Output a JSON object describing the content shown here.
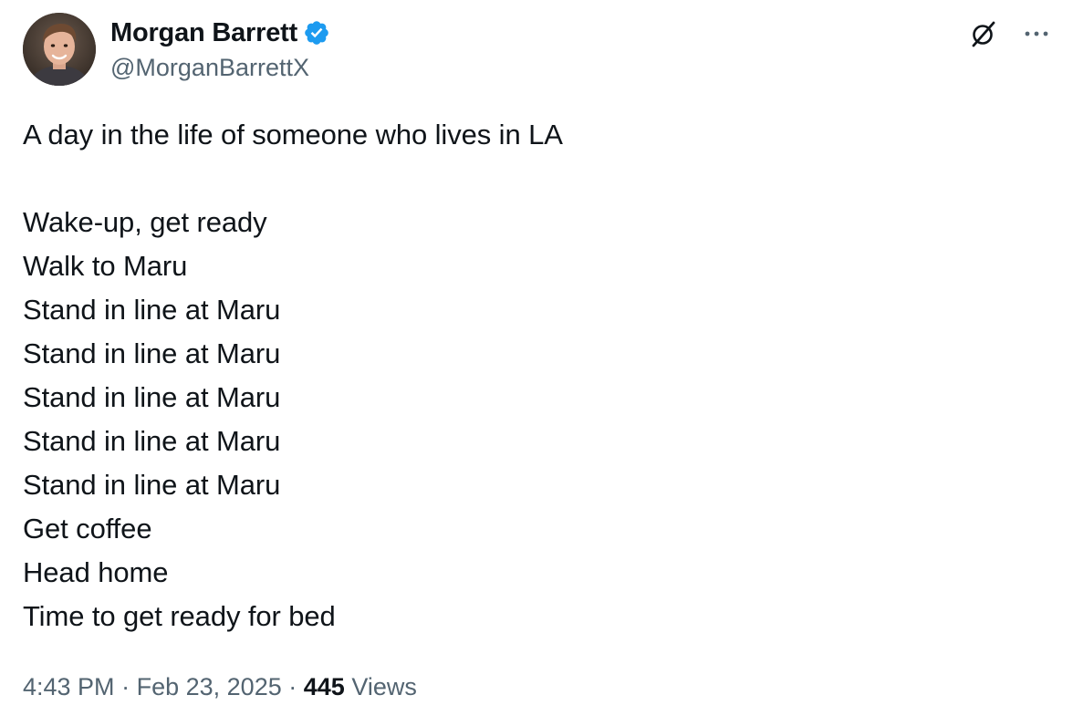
{
  "author": {
    "display_name": "Morgan Barrett",
    "handle": "@MorganBarrettX",
    "verified": true,
    "verified_color": "#1d9bf0",
    "avatar_icon": "profile-photo"
  },
  "actions": {
    "grok_icon": "grok-icon",
    "more_icon": "more-horizontal-icon"
  },
  "tweet": {
    "first_line": "A day in the life of someone who lives in LA",
    "lines": [
      "Wake-up, get ready",
      "Walk to Maru",
      "Stand in line at Maru",
      "Stand in line at Maru",
      "Stand in line at Maru",
      "Stand in line at Maru",
      "Stand in line at Maru",
      "Get coffee",
      "Head home",
      "Time to get ready for bed"
    ]
  },
  "meta": {
    "time": "4:43 PM",
    "separator": "·",
    "date": "Feb 23, 2025",
    "views_count": "445",
    "views_label": "Views"
  },
  "colors": {
    "text_primary": "#0f1419",
    "text_secondary": "#536471",
    "background": "#ffffff"
  }
}
